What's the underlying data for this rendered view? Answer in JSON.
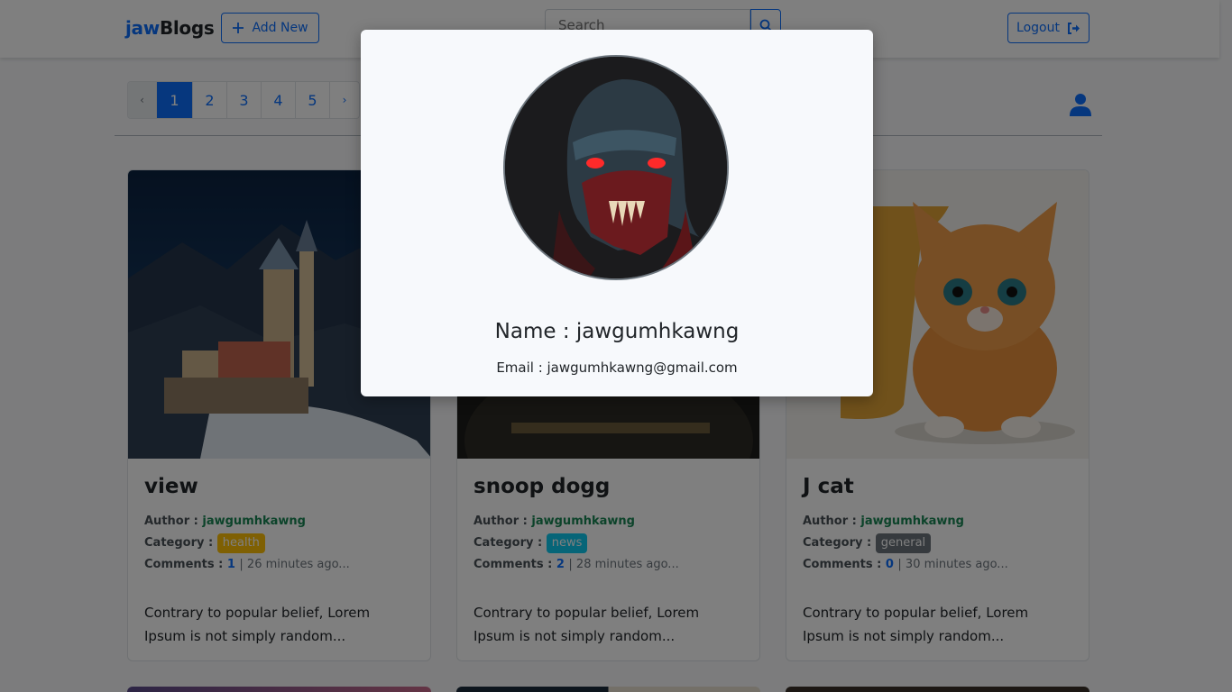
{
  "navbar": {
    "brand_accent": "jaw",
    "brand_rest": "Blogs",
    "add_new_label": "Add New",
    "search_placeholder": "Search",
    "logout_label": "Logout"
  },
  "pagination": {
    "prev": "‹",
    "pages": [
      "1",
      "2",
      "3",
      "4",
      "5"
    ],
    "active_page": "1",
    "next": "›"
  },
  "posts": [
    {
      "title": "view",
      "author_label": "Author :",
      "author": "jawgumhkawng",
      "category_label": "Category :",
      "category": "health",
      "category_color": "#ffc107",
      "comments_label": "Comments :",
      "comments": "1",
      "time": "| 26 minutes ago...",
      "excerpt": "Contrary to popular belief, Lorem Ipsum is not simply random..."
    },
    {
      "title": "snoop dogg",
      "author_label": "Author :",
      "author": "jawgumhkawng",
      "category_label": "Category :",
      "category": "news",
      "category_color": "#0dcaf0",
      "comments_label": "Comments :",
      "comments": "2",
      "time": "| 28 minutes ago...",
      "excerpt": "Contrary to popular belief, Lorem Ipsum is not simply random..."
    },
    {
      "title": "J cat",
      "author_label": "Author :",
      "author": "jawgumhkawng",
      "category_label": "Category :",
      "category": "general",
      "category_color": "#6c757d",
      "comments_label": "Comments :",
      "comments": "0",
      "time": "| 30 minutes ago...",
      "excerpt": "Contrary to popular belief, Lorem Ipsum is not simply random..."
    }
  ],
  "profile_modal": {
    "name": "Name : jawgumhkawng",
    "email": "Email : jawgumhkawng@gmail.com"
  },
  "colors": {
    "primary": "#0d6efd",
    "author": "#198754",
    "overlay": "rgba(0,0,0,0.5)"
  }
}
